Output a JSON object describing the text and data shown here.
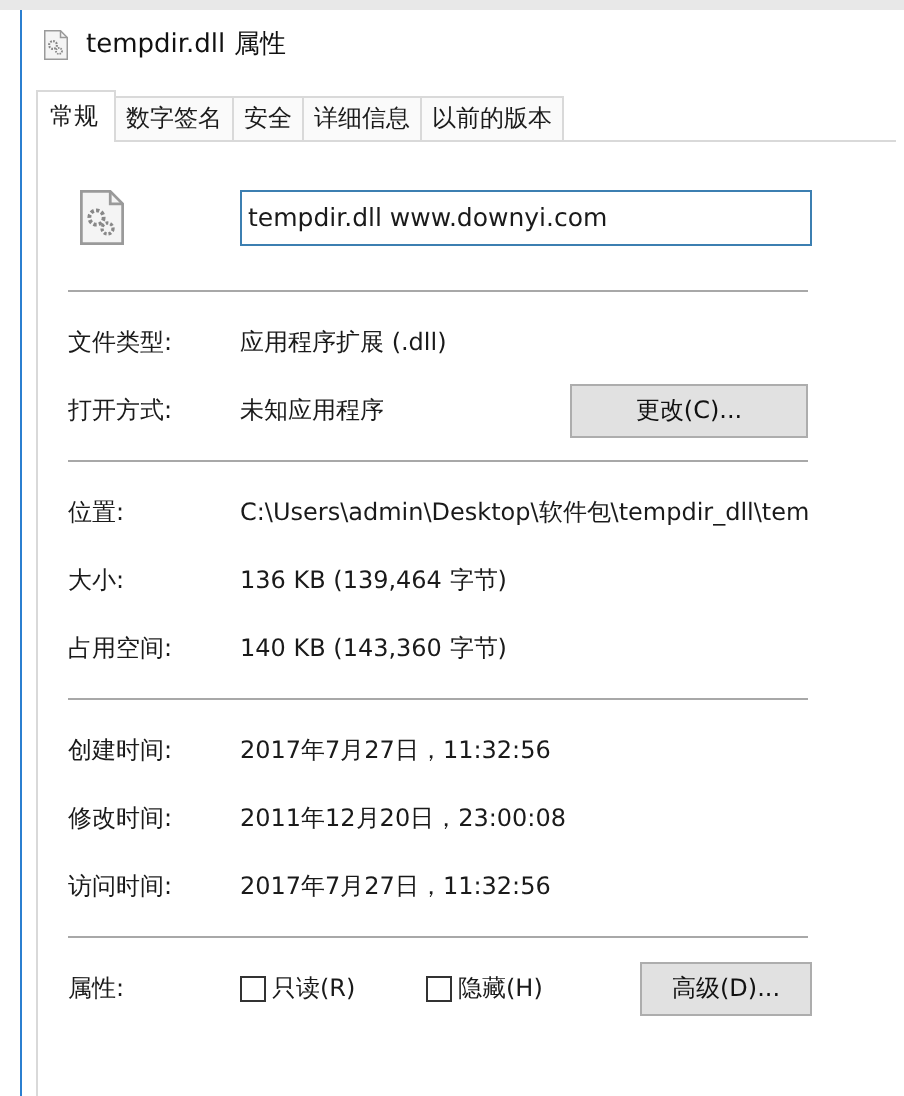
{
  "window": {
    "title": "tempdir.dll 属性"
  },
  "tabs": [
    {
      "label": "常规",
      "selected": true
    },
    {
      "label": "数字签名",
      "selected": false
    },
    {
      "label": "安全",
      "selected": false
    },
    {
      "label": "详细信息",
      "selected": false
    },
    {
      "label": "以前的版本",
      "selected": false
    }
  ],
  "file": {
    "name": "tempdir.dll www.downyi.com"
  },
  "sections": [
    {
      "rows": [
        {
          "kind": "text",
          "label": "文件类型:",
          "value": "应用程序扩展 (.dll)"
        },
        {
          "kind": "text_button",
          "label": "打开方式:",
          "value": "未知应用程序",
          "button": "更改(C)..."
        }
      ]
    },
    {
      "rows": [
        {
          "kind": "text",
          "label": "位置:",
          "value": "C:\\Users\\admin\\Desktop\\软件包\\tempdir_dll\\tem"
        },
        {
          "kind": "text",
          "label": "大小:",
          "value": "136 KB (139,464 字节)"
        },
        {
          "kind": "text",
          "label": "占用空间:",
          "value": "140 KB (143,360 字节)"
        }
      ]
    },
    {
      "rows": [
        {
          "kind": "text",
          "label": "创建时间:",
          "value": "2017年7月27日，11:32:56"
        },
        {
          "kind": "text",
          "label": "修改时间:",
          "value": "2011年12月20日，23:00:08"
        },
        {
          "kind": "text",
          "label": "访问时间:",
          "value": "2017年7月27日，11:32:56"
        }
      ]
    },
    {
      "rows": [
        {
          "kind": "checkboxes",
          "label": "属性:",
          "checkboxes": [
            {
              "label": "只读(R)",
              "checked": false
            },
            {
              "label": "隐藏(H)",
              "checked": false
            }
          ],
          "button": "高级(D)..."
        }
      ]
    }
  ]
}
